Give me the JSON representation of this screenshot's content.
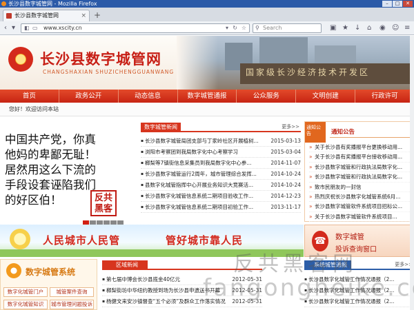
{
  "window": {
    "title": "长沙县数字城管网 - Mozilla Firefox",
    "controls": [
      "–",
      "□",
      "✕"
    ]
  },
  "browser": {
    "tab_title": "长沙县数字城管网",
    "tab_close": "×",
    "new_tab": "+",
    "url": "www.xscity.cn",
    "search_placeholder": "Search"
  },
  "site": {
    "title": "长沙县数字城管网",
    "subtitle": "CHANGSHAXIAN SHUZICHENGGUANWANG",
    "header_wall_text": "国家级长沙经济技术开发区"
  },
  "menu": [
    "首页",
    "政务公开",
    "动态信息",
    "数字城管通报",
    "公众服务",
    "文明创建",
    "行政许可"
  ],
  "welcome": "您好！欢迎访问本站",
  "slogan": {
    "lines": [
      "中国共产党，你真",
      "他妈的卑鄙无耻！",
      "居然用这么下流的",
      "手段设套诬陷我们",
      "的好区伯！"
    ],
    "seal": [
      "反共",
      "黑客"
    ]
  },
  "news": {
    "tab": "数字城管新闻",
    "more": "更多>>",
    "items": [
      {
        "title": "长沙县数字城管局团支部与丁家岭社区开展植树...",
        "date": "2015-03-13"
      },
      {
        "title": "浏阳市考察团到我局数字化中心考察学习",
        "date": "2015-03-04"
      },
      {
        "title": "榔梨等7镇街信息采集员到我局数字化中心参...",
        "date": "2014-11-07"
      },
      {
        "title": "长沙县数字城管运行2周年，城市管理综合发挥...",
        "date": "2014-10-24"
      },
      {
        "title": "县数字化城管指挥中心开展业务知识大竞赛活...",
        "date": "2014-10-24"
      },
      {
        "title": "长沙县数字化城管信息系统二期项目验收工作...",
        "date": "2014-12-23"
      },
      {
        "title": "长沙县数字化城管信息系统二期项目初验工作...",
        "date": "2013-11-17"
      }
    ]
  },
  "notice": {
    "ribbon": "通知公告",
    "title": "通知公告",
    "items": [
      "关于长沙县有奖播报平台更换移动用...",
      "关于长沙县有奖播报平台接收移动用...",
      "长沙县数字城管和行政执法局数字化...",
      "长沙县数字城管和行政执法局数字化...",
      "致市民朋友的一封信",
      "热烈庆祝长沙县数字化城管系统6月...",
      "长沙县数字城管软件系统项目招标公...",
      "关于长沙县数字城管软件系统项目..."
    ]
  },
  "banner": {
    "left": "人民城市人民管",
    "right": "管好城市靠人民"
  },
  "hotline": {
    "line1": "数字城管",
    "line2": "投诉查询窗口"
  },
  "system": {
    "title": "数字城管系统",
    "buttons": [
      "数字化城管门户",
      "城管案件查询",
      "数字化城管知识",
      "城市管理问题投诉"
    ]
  },
  "region_news": {
    "tab": "区域新闻",
    "items": [
      {
        "title": "第七届中博会长沙县揽金40亿元",
        "date": "2012-05-31"
      },
      {
        "title": "榔梨街坊中华纽约教授到场为长沙县申遗送书开幕",
        "date": "2012-05-31"
      },
      {
        "title": "杨健文来安沙镇督查“五个必须”及群众工作落实情况",
        "date": "2012-05-31"
      }
    ]
  },
  "notice2": {
    "tab": "系统城管通报",
    "more": "更多>>",
    "items": [
      "长沙县数字化城管工作情况通报（2...",
      "长沙县数字化城管工作情况通报（2...",
      "长沙县数字化城管工作情况通报（2..."
    ]
  },
  "watermark": {
    "line1": "反共黑客网",
    "line2": "fangongheike.com"
  }
}
